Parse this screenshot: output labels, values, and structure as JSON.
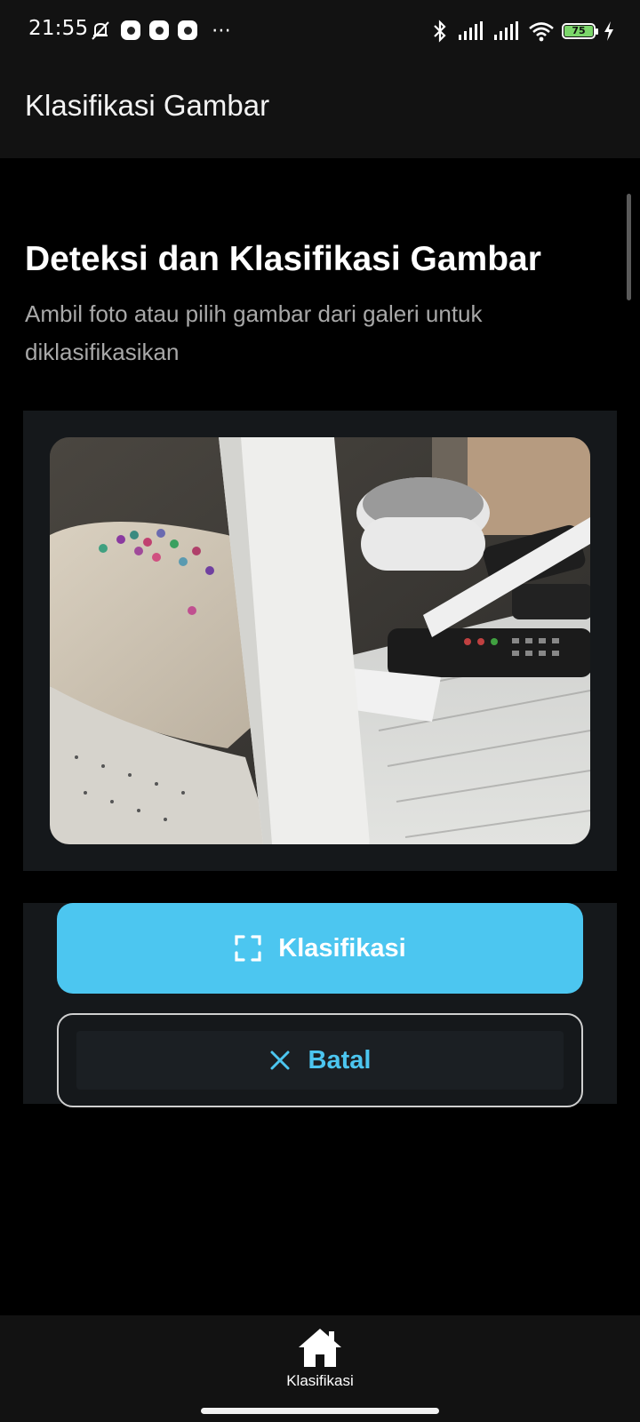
{
  "status_bar": {
    "time": "21:55",
    "more_indicator": "⋯",
    "battery_level": "75",
    "icons": [
      "mute-bell-icon",
      "notification-icon",
      "notification-icon",
      "notification-icon",
      "bluetooth-icon",
      "signal-icon",
      "signal-icon",
      "wifi-icon",
      "battery-icon",
      "charging-icon"
    ]
  },
  "app_bar": {
    "title": "Klasifikasi Gambar"
  },
  "main": {
    "heading": "Deteksi dan Klasifikasi Gambar",
    "subtitle": "Ambil foto atau pilih gambar dari galeri untuk diklasifikasikan",
    "photo": {
      "description_icon": "photo-preview"
    },
    "classify_button": {
      "label": "Klasifikasi",
      "icon": "scan-frame-icon",
      "color": "#4cc6f0"
    },
    "cancel_button": {
      "label": "Batal",
      "icon": "close-icon",
      "color": "#4cc6f0"
    }
  },
  "bottom_nav": {
    "items": [
      {
        "label": "Klasifikasi",
        "icon": "home-icon",
        "active": true
      }
    ]
  },
  "colors": {
    "background": "#000000",
    "surface": "#121212",
    "card": "#15181b",
    "accent": "#4cc6f0"
  }
}
